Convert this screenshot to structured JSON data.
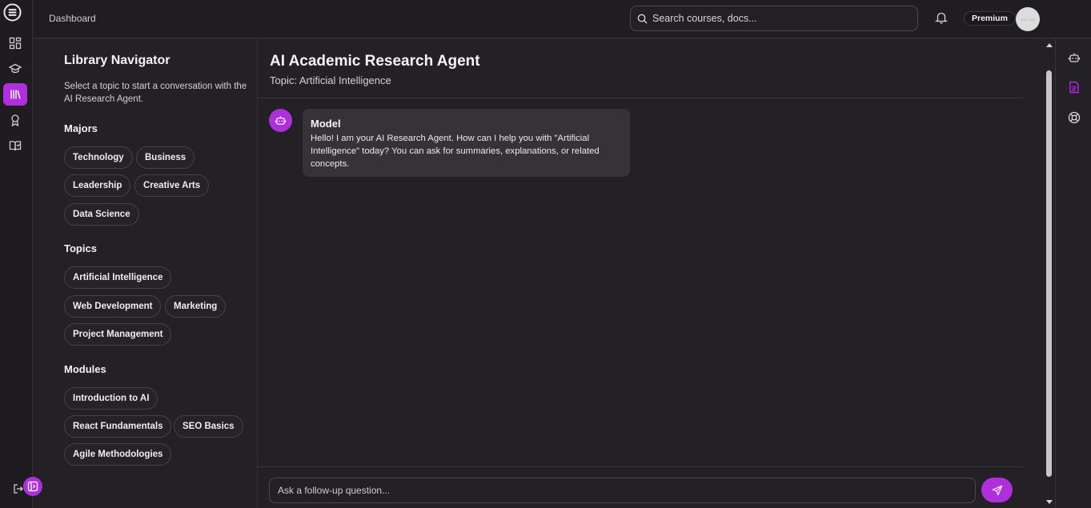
{
  "colors": {
    "accent": "#b02fdc",
    "background": "#242126",
    "surface": "#353238"
  },
  "rail": {
    "items": [
      {
        "name": "menu-icon"
      },
      {
        "name": "dashboard-grid-icon"
      },
      {
        "name": "graduation-cap-icon"
      },
      {
        "name": "library-icon",
        "active": true
      },
      {
        "name": "award-icon"
      },
      {
        "name": "book-open-icon"
      }
    ],
    "logout_icon": "logout-icon"
  },
  "header": {
    "breadcrumb": "Dashboard",
    "search_placeholder": "Search courses, docs...",
    "badge": "Premium",
    "avatar_text": "100 × 100"
  },
  "navigator": {
    "title": "Library Navigator",
    "description": "Select a topic to start a conversation with the AI Research Agent.",
    "sections": [
      {
        "title": "Majors",
        "chips": [
          "Technology",
          "Business",
          "Leadership",
          "Creative Arts",
          "Data Science"
        ]
      },
      {
        "title": "Topics",
        "chips": [
          "Artificial Intelligence",
          "Web Development",
          "Marketing",
          "Project Management"
        ]
      },
      {
        "title": "Modules",
        "chips": [
          "Introduction to AI",
          "React Fundamentals",
          "SEO Basics",
          "Agile Methodologies"
        ]
      }
    ]
  },
  "chat": {
    "title": "AI Academic Research Agent",
    "topic": "Topic: Artificial Intelligence",
    "messages": [
      {
        "sender": "Model",
        "text": "Hello! I am your AI Research Agent. How can I help you with \"Artificial Intelligence\" today? You can ask for summaries, explanations, or related concepts."
      }
    ],
    "input_placeholder": "Ask a follow-up question..."
  },
  "right_rail": {
    "items": [
      "bot-icon",
      "document-icon",
      "help-lifebuoy-icon"
    ]
  }
}
